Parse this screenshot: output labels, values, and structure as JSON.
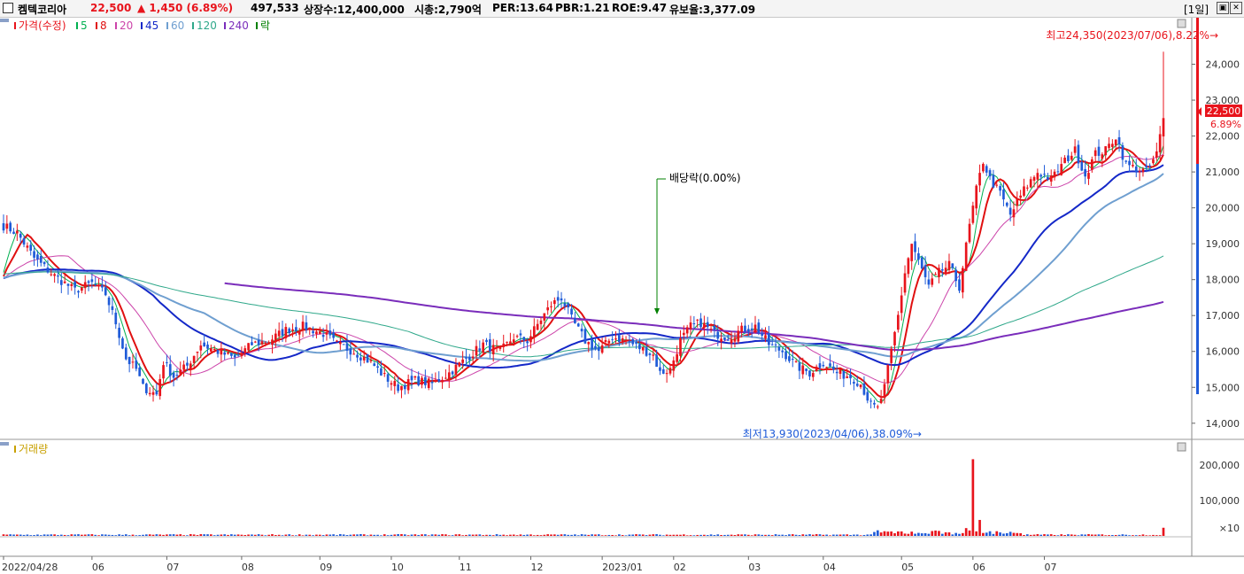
{
  "header": {
    "name": "켐텍코리아",
    "price": "22,500",
    "change": "▲ 1,450 (6.89%)",
    "volume": "497,533",
    "shares": "상장수:12,400,000",
    "mcap": "시총:2,790억",
    "per": "PER:13.64",
    "pbr": "PBR:1.21",
    "roe": "ROE:9.47",
    "float": "유보율:3,377.09",
    "period": "[1일]"
  },
  "legend": {
    "price": "가격(수정)",
    "ma": [
      "5",
      "8",
      "20",
      "45",
      "60",
      "120",
      "240"
    ],
    "extra": "락",
    "volume": "거래량"
  },
  "colors": {
    "up": "#e8141c",
    "down": "#1f5bd8",
    "ma5": "#00b050",
    "ma8": "#e01010",
    "ma20": "#cc44aa",
    "ma45": "#1428c8",
    "ma60": "#6f9fd0",
    "ma120": "#2fa88a",
    "ma240": "#7a2dbb"
  },
  "annotations": {
    "high": "최고24,350(2023/07/06),8.22%→",
    "low": "최저13,930(2023/04/06),38.09%→",
    "dividend": "배당락(0.00%)",
    "last_price": "22,500",
    "last_pct": "6.89%"
  },
  "chart_data": {
    "type": "candlestick",
    "x_range": [
      "2022/04/28",
      "2023/07/06"
    ],
    "price_axis": {
      "min": 13600,
      "max": 25000,
      "ticks": [
        "14,000",
        "15,000",
        "16,000",
        "17,000",
        "18,000",
        "19,000",
        "20,000",
        "21,000",
        "22,000",
        "23,000",
        "24,000"
      ]
    },
    "volume_axis": {
      "ticks": [
        "100,000",
        "200,000"
      ],
      "unit": "×10"
    },
    "x_labels": [
      "2022/04/28",
      "06",
      "07",
      "08",
      "09",
      "10",
      "11",
      "12",
      "2023/01",
      "02",
      "03",
      "04",
      "05",
      "06",
      "07"
    ],
    "price_keypoints": [
      [
        0,
        19500
      ],
      [
        4,
        19300
      ],
      [
        9,
        18600
      ],
      [
        15,
        18100
      ],
      [
        21,
        17700
      ],
      [
        26,
        17900
      ],
      [
        30,
        17600
      ],
      [
        33,
        16800
      ],
      [
        36,
        15800
      ],
      [
        39,
        15500
      ],
      [
        41,
        15000
      ],
      [
        45,
        14800
      ],
      [
        47,
        15700
      ],
      [
        50,
        15300
      ],
      [
        54,
        15600
      ],
      [
        58,
        16200
      ],
      [
        63,
        16000
      ],
      [
        68,
        15800
      ],
      [
        73,
        16200
      ],
      [
        78,
        16300
      ],
      [
        83,
        16600
      ],
      [
        88,
        16700
      ],
      [
        94,
        16500
      ],
      [
        98,
        16200
      ],
      [
        103,
        16000
      ],
      [
        108,
        15700
      ],
      [
        112,
        15300
      ],
      [
        116,
        15000
      ],
      [
        121,
        15200
      ],
      [
        126,
        15100
      ],
      [
        131,
        15400
      ],
      [
        136,
        15800
      ],
      [
        141,
        16200
      ],
      [
        146,
        16000
      ],
      [
        150,
        16400
      ],
      [
        154,
        16300
      ],
      [
        158,
        16900
      ],
      [
        161,
        17300
      ],
      [
        164,
        17500
      ],
      [
        167,
        16900
      ],
      [
        171,
        16300
      ],
      [
        175,
        16000
      ],
      [
        179,
        16400
      ],
      [
        183,
        16300
      ],
      [
        187,
        16100
      ],
      [
        191,
        15900
      ],
      [
        193,
        15400
      ],
      [
        196,
        15500
      ],
      [
        199,
        16300
      ],
      [
        202,
        16700
      ],
      [
        205,
        16800
      ],
      [
        209,
        16500
      ],
      [
        213,
        16400
      ],
      [
        217,
        16600
      ],
      [
        221,
        16700
      ],
      [
        225,
        16200
      ],
      [
        229,
        16000
      ],
      [
        233,
        15600
      ],
      [
        237,
        15400
      ],
      [
        241,
        15700
      ],
      [
        245,
        15400
      ],
      [
        249,
        15300
      ],
      [
        252,
        15100
      ],
      [
        255,
        14500
      ],
      [
        257,
        14400
      ],
      [
        259,
        15000
      ],
      [
        261,
        16000
      ],
      [
        263,
        17000
      ],
      [
        265,
        18200
      ],
      [
        267,
        19000
      ],
      [
        269,
        18500
      ],
      [
        272,
        17800
      ],
      [
        275,
        18200
      ],
      [
        278,
        18400
      ],
      [
        281,
        17800
      ],
      [
        284,
        19500
      ],
      [
        286,
        20500
      ],
      [
        288,
        21300
      ],
      [
        290,
        20800
      ],
      [
        293,
        20400
      ],
      [
        296,
        19800
      ],
      [
        300,
        20500
      ],
      [
        304,
        21000
      ],
      [
        308,
        20800
      ],
      [
        312,
        21300
      ],
      [
        315,
        21600
      ],
      [
        318,
        20900
      ],
      [
        321,
        21500
      ],
      [
        324,
        21600
      ],
      [
        327,
        22000
      ],
      [
        330,
        21200
      ],
      [
        333,
        21100
      ],
      [
        336,
        21000
      ],
      [
        339,
        21500
      ],
      [
        341,
        22500
      ]
    ],
    "candles_count": 342,
    "moving_averages": [
      "5",
      "8",
      "20",
      "45",
      "60",
      "120",
      "240"
    ],
    "volume_spikes": [
      [
        285,
        216000
      ],
      [
        287,
        45000
      ],
      [
        283,
        22000
      ],
      [
        341,
        23000
      ]
    ]
  }
}
